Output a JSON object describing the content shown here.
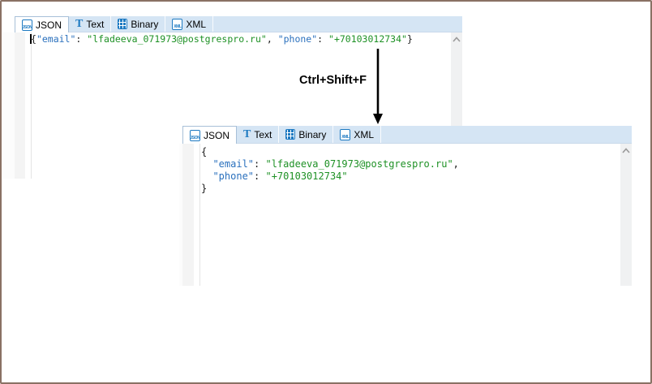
{
  "colors": {
    "frame_border": "#8a7164",
    "tabbar_bg": "#d5e5f4",
    "active_tab_bg": "#ffffff",
    "icon_blue": "#1e7ac2",
    "json_key_color": "#2a70bd",
    "json_string_color": "#1e9125",
    "code_punct_color": "#1a1a1a"
  },
  "icons": {
    "text_glyph": "T"
  },
  "annotation": {
    "shortcut_label": "Ctrl+Shift+F"
  },
  "panels": {
    "top": {
      "tabs": [
        {
          "label": "JSON",
          "icon": "json-document-icon",
          "icon_text": "JSON",
          "active": true
        },
        {
          "label": "Text",
          "icon": "text-icon",
          "active": false
        },
        {
          "label": "Binary",
          "icon": "binary-grid-icon",
          "active": false
        },
        {
          "label": "XML",
          "icon": "xml-document-icon",
          "icon_text": "XML",
          "active": false
        }
      ],
      "lines": [
        [
          {
            "c": "cursor",
            "t": ""
          },
          {
            "c": "p",
            "t": "{"
          },
          {
            "c": "k",
            "t": "\"email\""
          },
          {
            "c": "p",
            "t": ": "
          },
          {
            "c": "s",
            "t": "\"lfadeeva_071973@postgrespro.ru\""
          },
          {
            "c": "p",
            "t": ", "
          },
          {
            "c": "k",
            "t": "\"phone\""
          },
          {
            "c": "p",
            "t": ": "
          },
          {
            "c": "s",
            "t": "\"+70103012734\""
          },
          {
            "c": "p",
            "t": "}"
          }
        ]
      ]
    },
    "bottom": {
      "tabs": [
        {
          "label": "JSON",
          "icon": "json-document-icon",
          "icon_text": "JSON",
          "active": true
        },
        {
          "label": "Text",
          "icon": "text-icon",
          "active": false
        },
        {
          "label": "Binary",
          "icon": "binary-grid-icon",
          "active": false
        },
        {
          "label": "XML",
          "icon": "xml-document-icon",
          "icon_text": "XML",
          "active": false
        }
      ],
      "lines": [
        [
          {
            "c": "p",
            "t": "{"
          }
        ],
        [
          {
            "c": "p",
            "t": "  "
          },
          {
            "c": "k",
            "t": "\"email\""
          },
          {
            "c": "p",
            "t": ": "
          },
          {
            "c": "s",
            "t": "\"lfadeeva_071973@postgrespro.ru\""
          },
          {
            "c": "p",
            "t": ","
          }
        ],
        [
          {
            "c": "p",
            "t": "  "
          },
          {
            "c": "k",
            "t": "\"phone\""
          },
          {
            "c": "p",
            "t": ": "
          },
          {
            "c": "s",
            "t": "\"+70103012734\""
          }
        ],
        [
          {
            "c": "p",
            "t": "}"
          }
        ]
      ]
    }
  }
}
